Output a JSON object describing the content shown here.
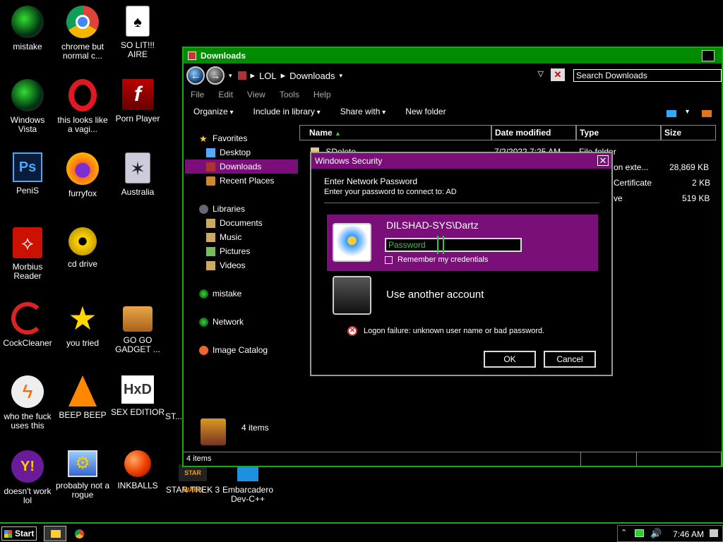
{
  "desktop_icons": [
    {
      "label": "mistake",
      "icon": "green-orb-icon"
    },
    {
      "label": "chrome but normal c...",
      "icon": "chrome-icon"
    },
    {
      "label": "SO LIT!!! AIRE",
      "icon": "solitaire-icon"
    },
    {
      "label": "Windows Vista",
      "icon": "green-orb-icon"
    },
    {
      "label": "this looks like a vagi...",
      "icon": "opera-icon"
    },
    {
      "label": "Porn Player",
      "icon": "flash-icon"
    },
    {
      "label": "PeniS",
      "icon": "photoshop-icon"
    },
    {
      "label": "furryfox",
      "icon": "firefox-icon"
    },
    {
      "label": "Australia",
      "icon": "spider-solitaire-icon"
    },
    {
      "label": "Morbius Reader",
      "icon": "acrobat-icon"
    },
    {
      "label": "cd drive",
      "icon": "cd-drive-icon"
    },
    {
      "label": "CockCleaner",
      "icon": "ccleaner-icon"
    },
    {
      "label": "you tried",
      "icon": "star-icon"
    },
    {
      "label": "GO GO GADGET ...",
      "icon": "briefcase-icon"
    },
    {
      "label": "who the fuck uses this",
      "icon": "winamp-icon"
    },
    {
      "label": "BEEP BEEP",
      "icon": "vlc-icon"
    },
    {
      "label": "SEX EDITIOR",
      "icon": "hxd-icon"
    },
    {
      "label": "ST...",
      "icon": "partial-icon"
    },
    {
      "label": "doesn't work lol",
      "icon": "yahoo-messenger-icon"
    },
    {
      "label": "probably not a rogue",
      "icon": "control-panel-icon"
    },
    {
      "label": "INKBALLS",
      "icon": "inkball-icon"
    },
    {
      "label": "STAR TREK 3",
      "icon": "star-wars-icon"
    },
    {
      "label": "Embarcadero Dev-C++",
      "icon": "devcpp-icon"
    }
  ],
  "explorer": {
    "title": "Downloads",
    "breadcrumb": [
      "LOL",
      "Downloads"
    ],
    "search_placeholder": "Search Downloads",
    "menu": [
      "File",
      "Edit",
      "View",
      "Tools",
      "Help"
    ],
    "commands": [
      "Organize",
      "Include in library",
      "Share with",
      "New folder"
    ],
    "nav": {
      "favorites": "Favorites",
      "favorites_items": [
        "Desktop",
        "Downloads",
        "Recent Places"
      ],
      "libraries": "Libraries",
      "libraries_items": [
        "Documents",
        "Music",
        "Pictures",
        "Videos"
      ],
      "mistake": "mistake",
      "network": "Network",
      "image_catalog": "Image Catalog"
    },
    "columns": [
      "Name",
      "Date modified",
      "Type",
      "Size"
    ],
    "files": [
      {
        "name": "SDelete",
        "date": "7/2/2022 7:25 AM",
        "type": "File folder",
        "size": ""
      },
      {
        "name": "",
        "date": "",
        "type": "on exte...",
        "size": "28,869 KB"
      },
      {
        "name": "",
        "date": "",
        "type": "Certificate",
        "size": "2 KB"
      },
      {
        "name": "",
        "date": "",
        "type": "ve",
        "size": "519 KB"
      }
    ],
    "item_count": "4 items",
    "status_count": "4 items"
  },
  "dialog": {
    "title": "Windows Security",
    "heading": "Enter Network Password",
    "subheading": "Enter your password to connect to: AD",
    "account_name": "DILSHAD-SYS\\Dartz",
    "password_placeholder": "Password",
    "remember_label": "Remember my credentials",
    "other_account": "Use another account",
    "error": "Logon failure: unknown user name or bad password.",
    "ok": "OK",
    "cancel": "Cancel"
  },
  "taskbar": {
    "start": "Start",
    "clock": "7:46 AM"
  },
  "colors": {
    "accent_green": "#1ea51e",
    "titlebar_green": "#008b00",
    "purple": "#7a0f7a"
  }
}
